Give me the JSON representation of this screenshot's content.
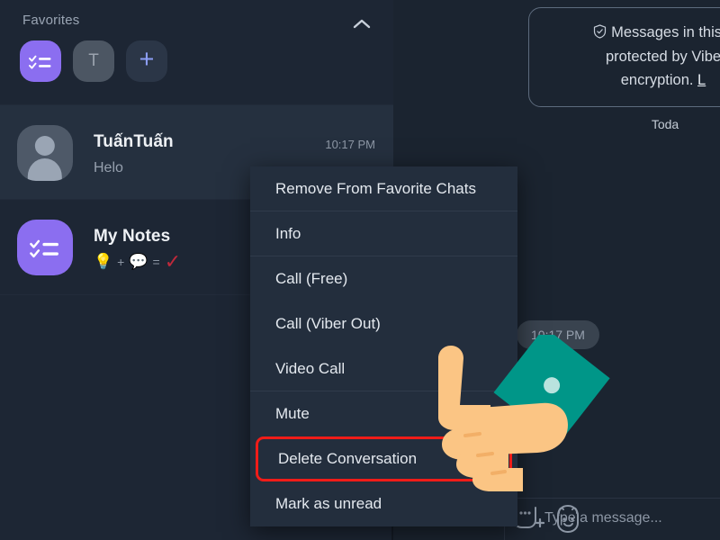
{
  "sidebar": {
    "favorites": {
      "title": "Favorites",
      "collapse_icon": "chevron-up-icon",
      "avatars": [
        {
          "type": "my-notes",
          "icon": "checklist-icon",
          "color": "#8b6ef0",
          "label": ""
        },
        {
          "type": "contact",
          "icon": "letter-avatar",
          "color": "#4c5663",
          "label": "T"
        },
        {
          "type": "add",
          "icon": "plus-icon",
          "color": "#2b3647",
          "label": "+"
        }
      ]
    },
    "chats": [
      {
        "name": "TuấnTuấn",
        "preview": "Helo",
        "time": "10:17 PM",
        "avatar_icon": "person-avatar-icon",
        "selected": true
      },
      {
        "name": "My Notes",
        "preview_emoji": [
          "💡",
          "+",
          "💬",
          "=",
          "✓"
        ],
        "time": "",
        "avatar_icon": "checklist-icon",
        "selected": false
      }
    ]
  },
  "context_menu": {
    "items": [
      {
        "label": "Remove From Favorite Chats",
        "divider_after": true,
        "highlighted": false
      },
      {
        "label": "Info",
        "divider_after": true,
        "highlighted": false
      },
      {
        "label": "Call (Free)",
        "divider_after": false,
        "highlighted": false
      },
      {
        "label": "Call (Viber Out)",
        "divider_after": false,
        "highlighted": false
      },
      {
        "label": "Video Call",
        "divider_after": true,
        "highlighted": false
      },
      {
        "label": "Mute",
        "divider_after": false,
        "highlighted": false
      },
      {
        "label": "Delete Conversation",
        "divider_after": false,
        "highlighted": true
      },
      {
        "label": "Mark as unread",
        "divider_after": false,
        "highlighted": false
      }
    ],
    "highlight_color": "#f01c18"
  },
  "chat_pane": {
    "encryption_notice": {
      "icon": "shield-icon",
      "line1": "Messages in this c",
      "line2": "protected by Vibe",
      "line3_text": "encryption. ",
      "line3_link": "L"
    },
    "day_separator": "Toda",
    "message_time_bubble": "10:17 PM",
    "composer": {
      "placeholder": "Type a message...",
      "icons": [
        "divider-icon",
        "sticker-plus-icon",
        "emoji-icon"
      ]
    }
  },
  "cursor": {
    "type": "pointing-hand-cursor",
    "skin_color": "#fbc584",
    "sleeve_color": "#009688",
    "cuff_button_color": "#b9e3de"
  },
  "theme": {
    "bg_dark": "#1b2430",
    "sidebar_bg": "#1d2634",
    "selected_row": "#25303f",
    "menu_bg": "#232e3d",
    "accent_purple": "#8b6ef0",
    "text_primary": "#e4e9ef",
    "text_secondary": "#8d97a5"
  }
}
